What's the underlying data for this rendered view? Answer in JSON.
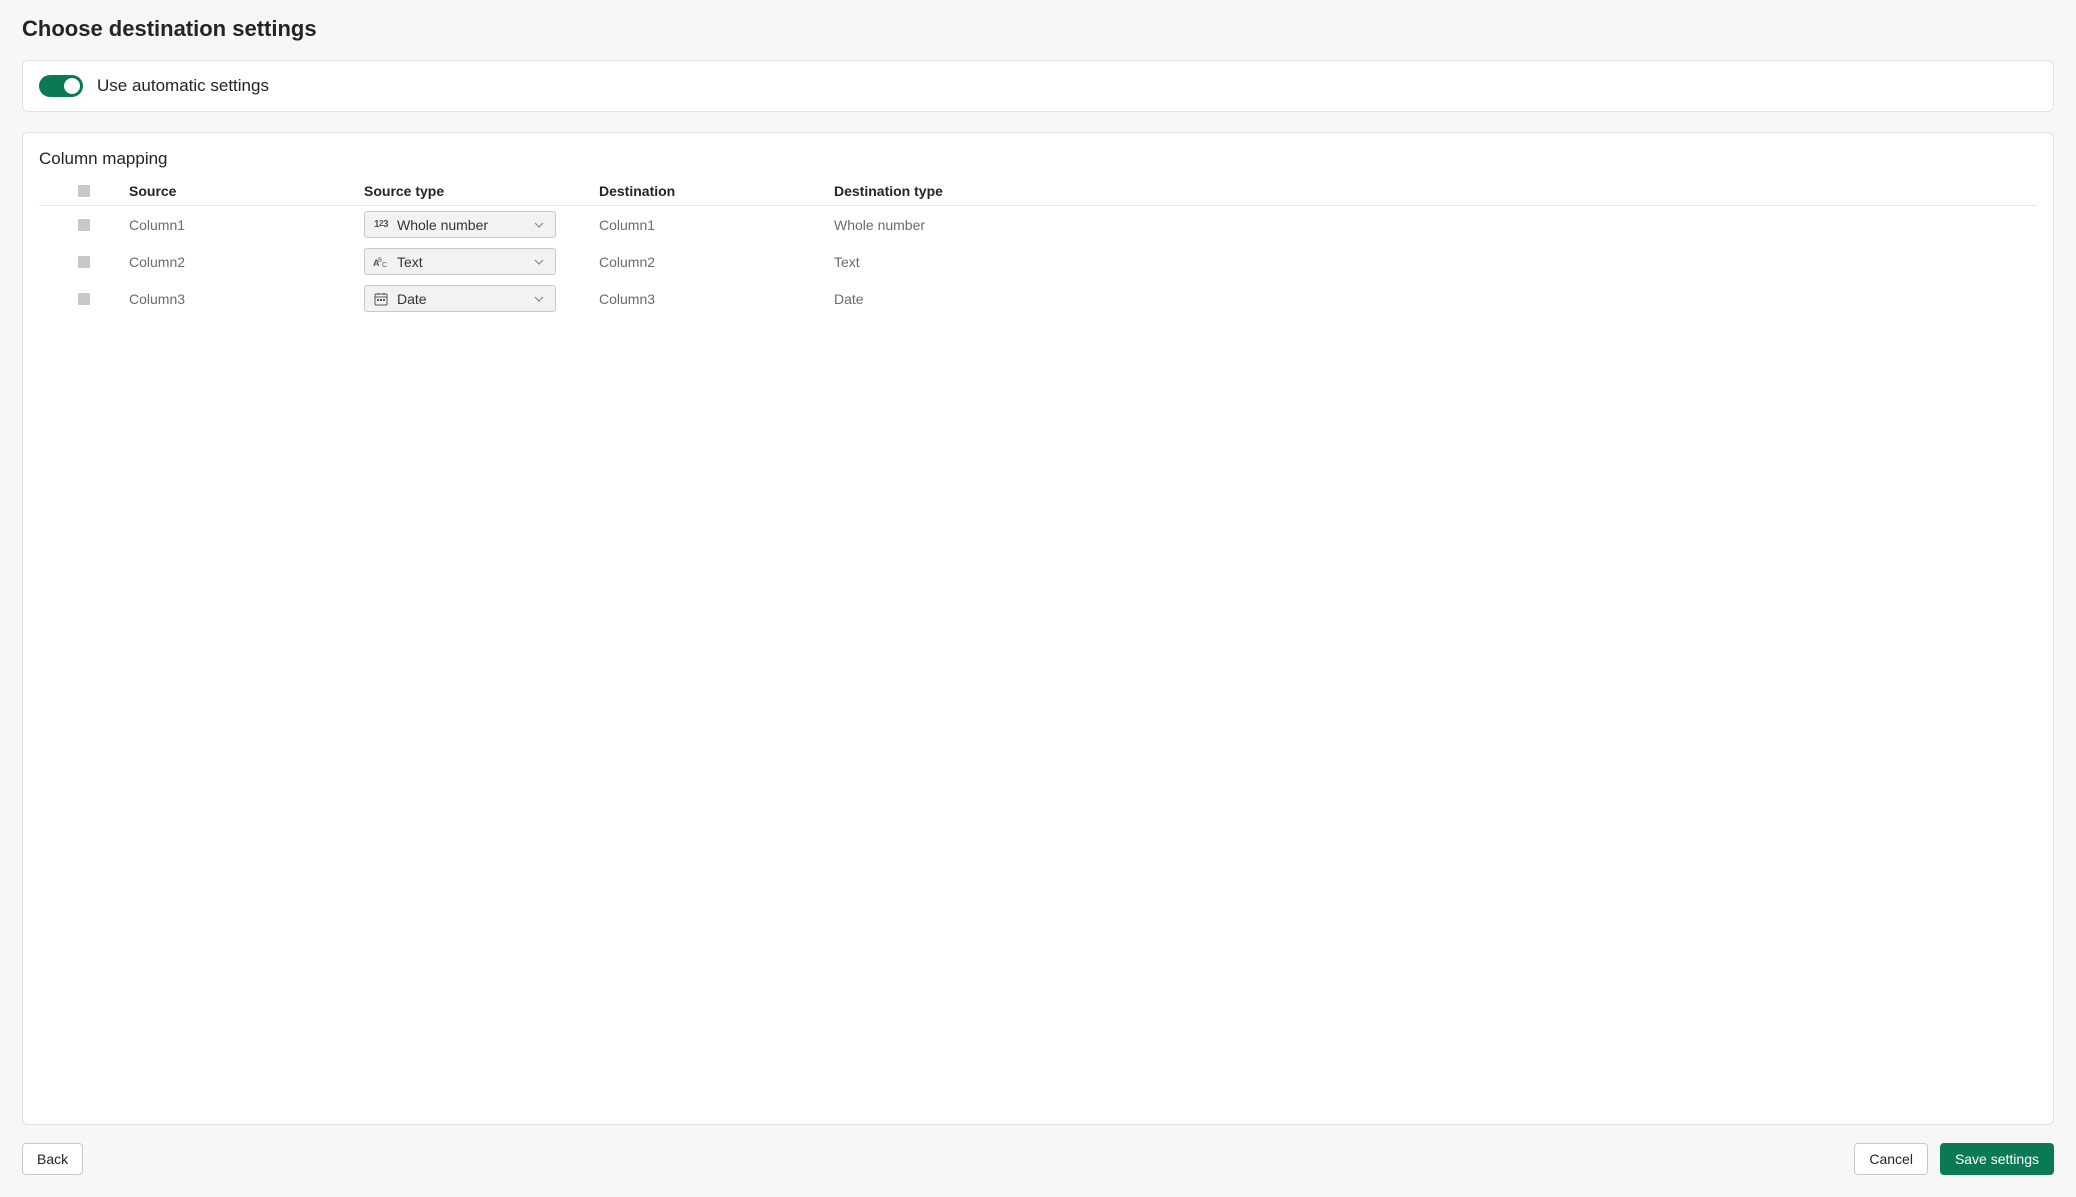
{
  "page_title": "Choose destination settings",
  "auto_toggle": {
    "label": "Use automatic settings",
    "on": true
  },
  "mapping": {
    "section_title": "Column mapping",
    "headers": {
      "source": "Source",
      "source_type": "Source type",
      "destination": "Destination",
      "destination_type": "Destination type"
    },
    "rows": [
      {
        "source": "Column1",
        "source_type": "Whole number",
        "destination": "Column1",
        "destination_type": "Whole number",
        "icon": "number"
      },
      {
        "source": "Column2",
        "source_type": "Text",
        "destination": "Column2",
        "destination_type": "Text",
        "icon": "text"
      },
      {
        "source": "Column3",
        "source_type": "Date",
        "destination": "Column3",
        "destination_type": "Date",
        "icon": "date"
      }
    ]
  },
  "footer": {
    "back": "Back",
    "cancel": "Cancel",
    "save": "Save settings"
  }
}
